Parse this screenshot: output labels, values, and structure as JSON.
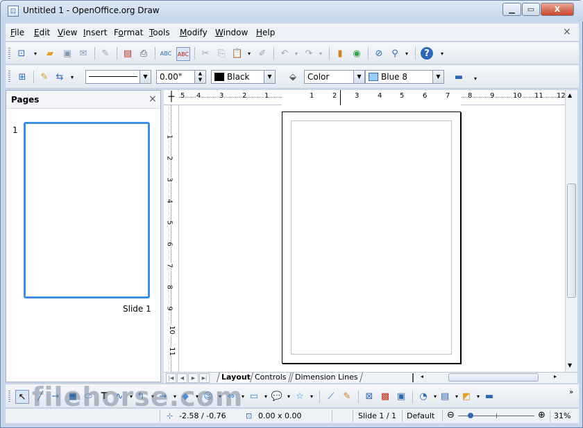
{
  "window": {
    "title": "Untitled 1 - OpenOffice.org Draw",
    "minimize_icon": "minimize-icon",
    "maximize_icon": "maximize-icon",
    "close_icon": "close-icon"
  },
  "menubar": {
    "items": [
      {
        "label": "File",
        "mnemonic": "F",
        "rest": "ile"
      },
      {
        "label": "Edit",
        "mnemonic": "E",
        "rest": "dit"
      },
      {
        "label": "View",
        "mnemonic": "V",
        "rest": "iew"
      },
      {
        "label": "Insert",
        "mnemonic": "I",
        "rest": "nsert"
      },
      {
        "label": "Format",
        "mnemonic": "o",
        "pre": "F",
        "rest": "rmat"
      },
      {
        "label": "Tools",
        "mnemonic": "T",
        "rest": "ools"
      },
      {
        "label": "Modify",
        "mnemonic": "M",
        "rest": "odify"
      },
      {
        "label": "Window",
        "mnemonic": "W",
        "rest": "indow"
      },
      {
        "label": "Help",
        "mnemonic": "H",
        "rest": "elp"
      }
    ],
    "close_doc": "×"
  },
  "line_fill_toolbar": {
    "line_width": "0.00\"",
    "line_color": "Black",
    "area_style": "Color",
    "fill_color": "Blue 8",
    "colors": {
      "black": "#000000",
      "blue8": "#99ccff"
    }
  },
  "pages_pane": {
    "title": "Pages",
    "close": "×",
    "slide_number": "1",
    "slide_label": "Slide 1"
  },
  "rulers": {
    "horizontal_ticks": [
      "5",
      "4",
      "3",
      "2",
      "1",
      "1",
      "2",
      "3",
      "4",
      "5",
      "6",
      "7",
      "8",
      "9",
      "10",
      "11",
      "12"
    ],
    "vertical_ticks": [
      "1",
      "2",
      "3",
      "4",
      "5",
      "6",
      "7",
      "8",
      "9",
      "10",
      "11"
    ]
  },
  "tabs": [
    {
      "label": "Layout",
      "active": true
    },
    {
      "label": "Controls",
      "active": false
    },
    {
      "label": "Dimension Lines",
      "active": false
    }
  ],
  "statusbar": {
    "position": "-2.58 / -0.76",
    "size": "0.00 x 0.00",
    "slide": "Slide 1 / 1",
    "layout": "Default",
    "zoom": "31%",
    "zoom_minus": "⊖",
    "zoom_plus": "⊕"
  },
  "watermark": "filehorse.com"
}
